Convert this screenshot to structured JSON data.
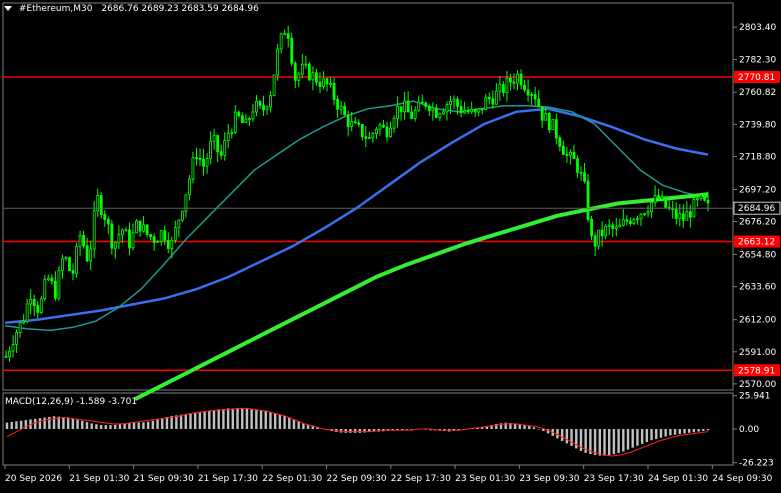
{
  "header": {
    "symbol_timeframe": "#Ethereum,M30",
    "ohlc": "2686.76 2689.23 2683.59 2684.96",
    "menu_icon": "triangle-down-icon"
  },
  "price_axis": {
    "labels": [
      "2803.40",
      "2782.30",
      "2760.82",
      "2739.80",
      "2718.80",
      "2697.20",
      "2676.20",
      "2654.80",
      "2633.60",
      "2612.00",
      "2591.00",
      "2570.00"
    ],
    "current_price": "2684.96",
    "range": [
      2566,
      2812
    ]
  },
  "levels": [
    {
      "value": 2770.81,
      "label": "2770.81"
    },
    {
      "value": 2663.12,
      "label": "2663.12"
    },
    {
      "value": 2578.91,
      "label": "2578.91"
    }
  ],
  "time_axis": {
    "labels": [
      "20 Sep 2026",
      "21 Sep 01:30",
      "21 Sep 09:30",
      "21 Sep 17:30",
      "22 Sep 01:30",
      "22 Sep 09:30",
      "22 Sep 17:30",
      "23 Sep 01:30",
      "23 Sep 09:30",
      "23 Sep 17:30",
      "24 Sep 01:30",
      "24 Sep 09:30"
    ]
  },
  "macd": {
    "label": "MACD(12,26,9) -1.589 -3.701",
    "axis_labels": [
      "25.941",
      "0.00",
      "-26.223"
    ],
    "range": [
      -28,
      28
    ]
  },
  "colors": {
    "background": "#000000",
    "candle": "#00ff00",
    "ma_fast": "#1e9b8f",
    "ma_mid": "#3a6ff0",
    "ma_slow": "#33ee33",
    "level": "#ff0000",
    "macd_hist": "#c0c0c0",
    "macd_signal": "#ff2020"
  },
  "chart_data": {
    "type": "candlestick",
    "description_key": "ohlc approx, 30-minute candles",
    "x": [
      "20 Sep 2026 00:00",
      "24 Sep 2026 09:30"
    ],
    "close_path": [
      2588,
      2602,
      2611,
      2630,
      2618,
      2640,
      2630,
      2655,
      2640,
      2668,
      2650,
      2692,
      2680,
      2660,
      2672,
      2662,
      2676,
      2668,
      2665,
      2670,
      2660,
      2680,
      2700,
      2722,
      2712,
      2730,
      2718,
      2736,
      2745,
      2738,
      2752,
      2748,
      2760,
      2790,
      2806,
      2770,
      2776,
      2772,
      2768,
      2765,
      2755,
      2745,
      2738,
      2735,
      2730,
      2740,
      2735,
      2748,
      2752,
      2745,
      2750,
      2755,
      2748,
      2752,
      2756,
      2750,
      2748,
      2745,
      2755,
      2758,
      2762,
      2768,
      2772,
      2765,
      2760,
      2745,
      2740,
      2730,
      2718,
      2715,
      2700,
      2660,
      2668,
      2672,
      2670,
      2676,
      2680,
      2683,
      2688,
      2691,
      2685,
      2680,
      2678,
      2684,
      2690,
      2685
    ],
    "ma_fast_path": [
      2608,
      2606,
      2605,
      2607,
      2611,
      2620,
      2632,
      2648,
      2665,
      2680,
      2695,
      2710,
      2720,
      2730,
      2738,
      2745,
      2750,
      2752,
      2755,
      2750,
      2748,
      2750,
      2752,
      2752,
      2751,
      2748,
      2740,
      2725,
      2710,
      2700,
      2695,
      2692
    ],
    "ma_mid_path": [
      2610,
      2612,
      2615,
      2618,
      2622,
      2626,
      2632,
      2640,
      2650,
      2660,
      2672,
      2685,
      2700,
      2715,
      2728,
      2740,
      2748,
      2750,
      2745,
      2738,
      2730,
      2724,
      2720
    ],
    "ma_slow_path": [
      2560,
      2570,
      2580,
      2590,
      2600,
      2610,
      2620,
      2630,
      2640,
      2648,
      2655,
      2662,
      2668,
      2674,
      2680,
      2684,
      2688,
      2690,
      2692,
      2694
    ],
    "macd_hist": [
      5,
      6,
      7,
      8,
      9,
      10,
      9,
      8,
      6,
      4,
      3,
      3,
      4,
      5,
      5,
      6,
      8,
      10,
      11,
      12,
      13,
      14,
      15,
      16,
      16,
      16,
      15,
      14,
      12,
      10,
      7,
      4,
      2,
      0,
      -2,
      -3,
      -3,
      -3,
      -2,
      -2,
      -1,
      -1,
      0,
      0,
      -1,
      -1,
      -2,
      -1,
      0,
      1,
      2,
      4,
      5,
      4,
      3,
      1,
      -2,
      -6,
      -10,
      -14,
      -18,
      -20,
      -21,
      -20,
      -18,
      -15,
      -12,
      -9,
      -7,
      -5,
      -4,
      -3,
      -2,
      -1
    ],
    "macd_signal": [
      -6,
      -2,
      2,
      5,
      7,
      8,
      9,
      8,
      7,
      6,
      5,
      4,
      4,
      5,
      6,
      7,
      8,
      9,
      10,
      12,
      13,
      14,
      15,
      15,
      16,
      16,
      15,
      14,
      12,
      10,
      7,
      4,
      2,
      0,
      -1,
      -2,
      -2,
      -2,
      -2,
      -1,
      -1,
      -1,
      -1,
      0,
      0,
      -1,
      -1,
      -1,
      0,
      1,
      2,
      3,
      4,
      4,
      3,
      2,
      0,
      -3,
      -7,
      -11,
      -15,
      -18,
      -20,
      -21,
      -20,
      -18,
      -15,
      -12,
      -9,
      -7,
      -5,
      -4,
      -3,
      -2
    ]
  }
}
